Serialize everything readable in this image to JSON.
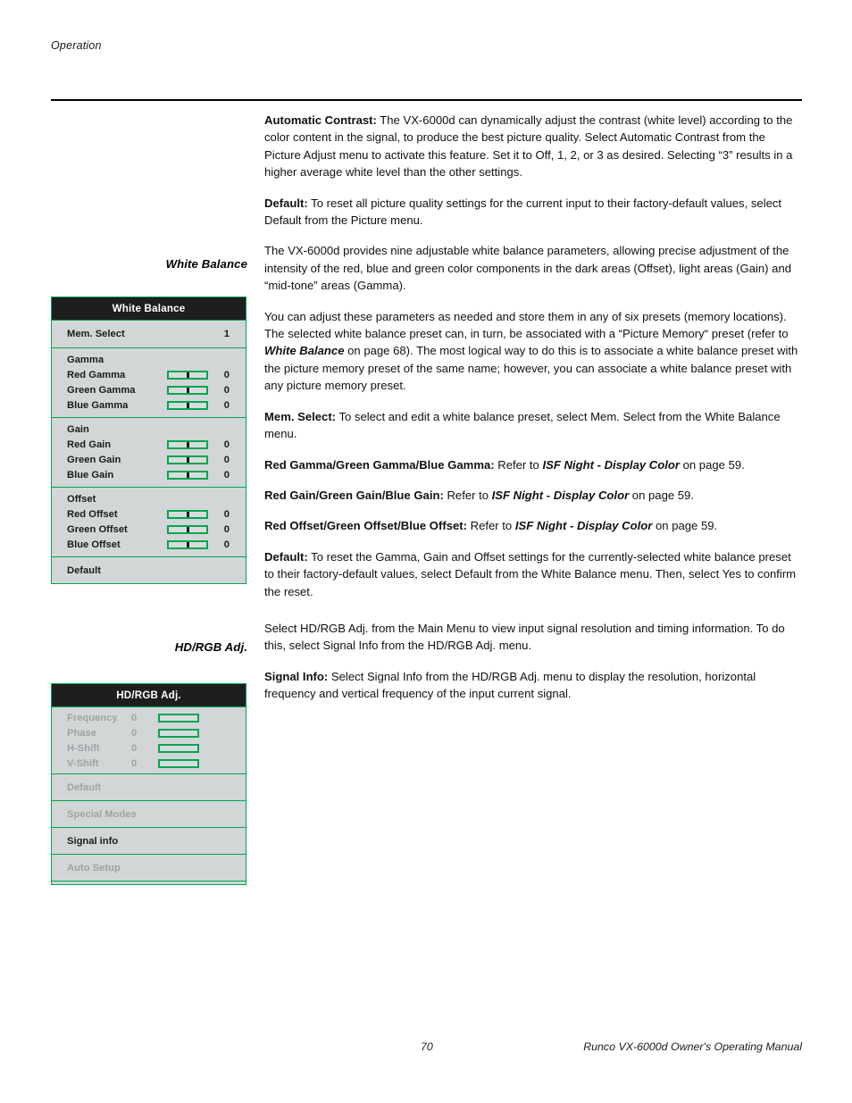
{
  "running_head": "Operation",
  "margin_headings": {
    "white_balance": "White Balance",
    "hd_rgb_adj": "HD/RGB Adj."
  },
  "body": {
    "automatic_contrast": {
      "term": "Automatic Contrast:",
      "text": " The VX-6000d can dynamically adjust the contrast (white level) according to the color content in the signal, to produce the best picture quality. Select Automatic Contrast from the Picture Adjust menu to activate this feature. Set it to Off, 1, 2, or 3 as desired. Selecting “3” results in a higher average white level than the other settings."
    },
    "default_picture": {
      "term": "Default:",
      "text": " To reset all picture quality settings for the current input to their factory-default values, select Default from the Picture menu."
    },
    "wb_intro": "The VX-6000d provides nine adjustable white balance parameters, allowing precise adjustment of the intensity of the red, blue and green color components in the dark areas (Offset), light areas (Gain) and “mid-tone” areas (Gamma).",
    "wb_presets": {
      "p1": "You can adjust these parameters as needed and store them in any of six presets (memory locations). The selected white balance preset can, in turn, be associated with a “Picture Memory“ preset (refer to ",
      "ref": "White Balance",
      "p2": " on page 68). The most logical way to do this is to associate a white balance preset with the picture memory preset of the same name; however, you can associate a white balance preset with any picture memory preset."
    },
    "mem_select": {
      "term": "Mem. Select:",
      "text": " To select and edit a white balance preset, select Mem. Select from the White Balance menu."
    },
    "gamma_ref": {
      "term": "Red Gamma/Green Gamma/Blue Gamma:",
      "mid": " Refer to ",
      "ref": "ISF Night - Display Color",
      "tail": " on page 59."
    },
    "gain_ref": {
      "term": "Red Gain/Green Gain/Blue Gain:",
      "mid": " Refer to ",
      "ref": "ISF Night - Display Color",
      "tail": " on page 59."
    },
    "offset_ref": {
      "term": "Red Offset/Green Offset/Blue Offset:",
      "mid": " Refer to ",
      "ref": "ISF Night - Display Color",
      "tail": " on page 59."
    },
    "default_wb": {
      "term": "Default:",
      "text": " To reset the Gamma, Gain and Offset settings for the currently-selected white balance preset to their factory-default values, select Default from the White Balance menu. Then, select Yes to confirm the reset."
    },
    "hd_intro": "Select HD/RGB Adj. from the Main Menu to view input signal resolution and timing information. To do this, select Signal Info from the HD/RGB Adj. menu.",
    "signal_info": {
      "term": "Signal Info:",
      "text": " Select Signal Info from the HD/RGB Adj. menu to display the resolution, horizontal frequency and vertical frequency of the input current signal."
    }
  },
  "osd": {
    "white_balance": {
      "title": "White Balance",
      "mem_select": {
        "label": "Mem. Select",
        "value": "1"
      },
      "groups": [
        {
          "label": "Gamma",
          "rows": [
            {
              "label": "Red Gamma",
              "value": "0"
            },
            {
              "label": "Green Gamma",
              "value": "0"
            },
            {
              "label": "Blue Gamma",
              "value": "0"
            }
          ]
        },
        {
          "label": "Gain",
          "rows": [
            {
              "label": "Red Gain",
              "value": "0"
            },
            {
              "label": "Green Gain",
              "value": "0"
            },
            {
              "label": "Blue Gain",
              "value": "0"
            }
          ]
        },
        {
          "label": "Offset",
          "rows": [
            {
              "label": "Red Offset",
              "value": "0"
            },
            {
              "label": "Green Offset",
              "value": "0"
            },
            {
              "label": "Blue Offset",
              "value": "0"
            }
          ]
        }
      ],
      "default_label": "Default"
    },
    "hd_rgb": {
      "title": "HD/RGB Adj.",
      "rows": [
        {
          "label": "Frequency",
          "value": "0"
        },
        {
          "label": "Phase",
          "value": "0"
        },
        {
          "label": "H-Shift",
          "value": "0"
        },
        {
          "label": "V-Shift",
          "value": "0"
        }
      ],
      "default_label": "Default",
      "special_modes_label": "Special Modes",
      "signal_info_label": "Signal info",
      "auto_setup_label": "Auto Setup"
    }
  },
  "footer": {
    "page_number": "70",
    "source": "Runco VX-6000d Owner's Operating Manual"
  },
  "colors": {
    "osd_border_green": "#00a651",
    "osd_background": "#d2d6d7",
    "osd_title_background": "#1e1e1e",
    "osd_disabled_text": "#9ea3a4"
  }
}
